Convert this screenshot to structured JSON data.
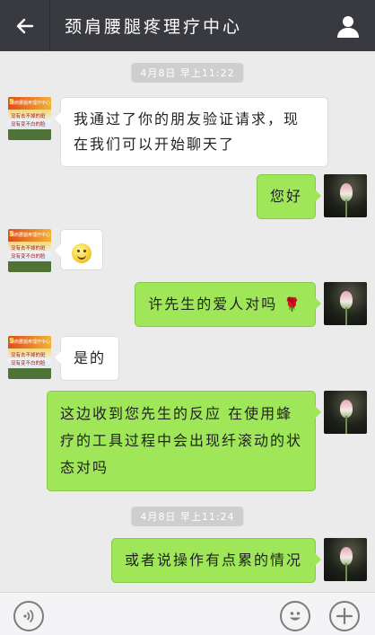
{
  "header": {
    "title": "颈肩腰腿疼理疗中心",
    "back_icon": "back-arrow-icon",
    "profile_icon": "person-icon"
  },
  "timestamps": [
    "4月8日 早上11:22",
    "4月8日 早上11:24"
  ],
  "messages": [
    {
      "side": "left",
      "text": "我通过了你的朋友验证请求，现在我们可以开始聊天了"
    },
    {
      "side": "right",
      "text": "您好"
    },
    {
      "side": "left",
      "emoji": "smile-emoji"
    },
    {
      "side": "right",
      "text": "许先生的爱人对吗",
      "emoji": "rose-emoji"
    },
    {
      "side": "left",
      "text": "是的"
    },
    {
      "side": "right",
      "text": "这边收到您先生的反应 在使用蜂疗的工具过程中会出现纤滚动的状态对吗"
    },
    {
      "side": "right",
      "text": "或者说操作有点累的情况"
    }
  ],
  "left_avatar": {
    "num": "5",
    "top_text": "颈肩腰腿疼理疗中心",
    "line1": "没有去不掉的斑",
    "line2": "没有变不白的脸"
  },
  "bottombar": {
    "voice_icon": "voice-icon",
    "emoji_icon": "emoji-icon",
    "plus_icon": "plus-icon"
  },
  "colors": {
    "topbar": "#393a3f",
    "bubble_right": "#9fe658",
    "bubble_left": "#ffffff",
    "background": "#ebebeb"
  }
}
